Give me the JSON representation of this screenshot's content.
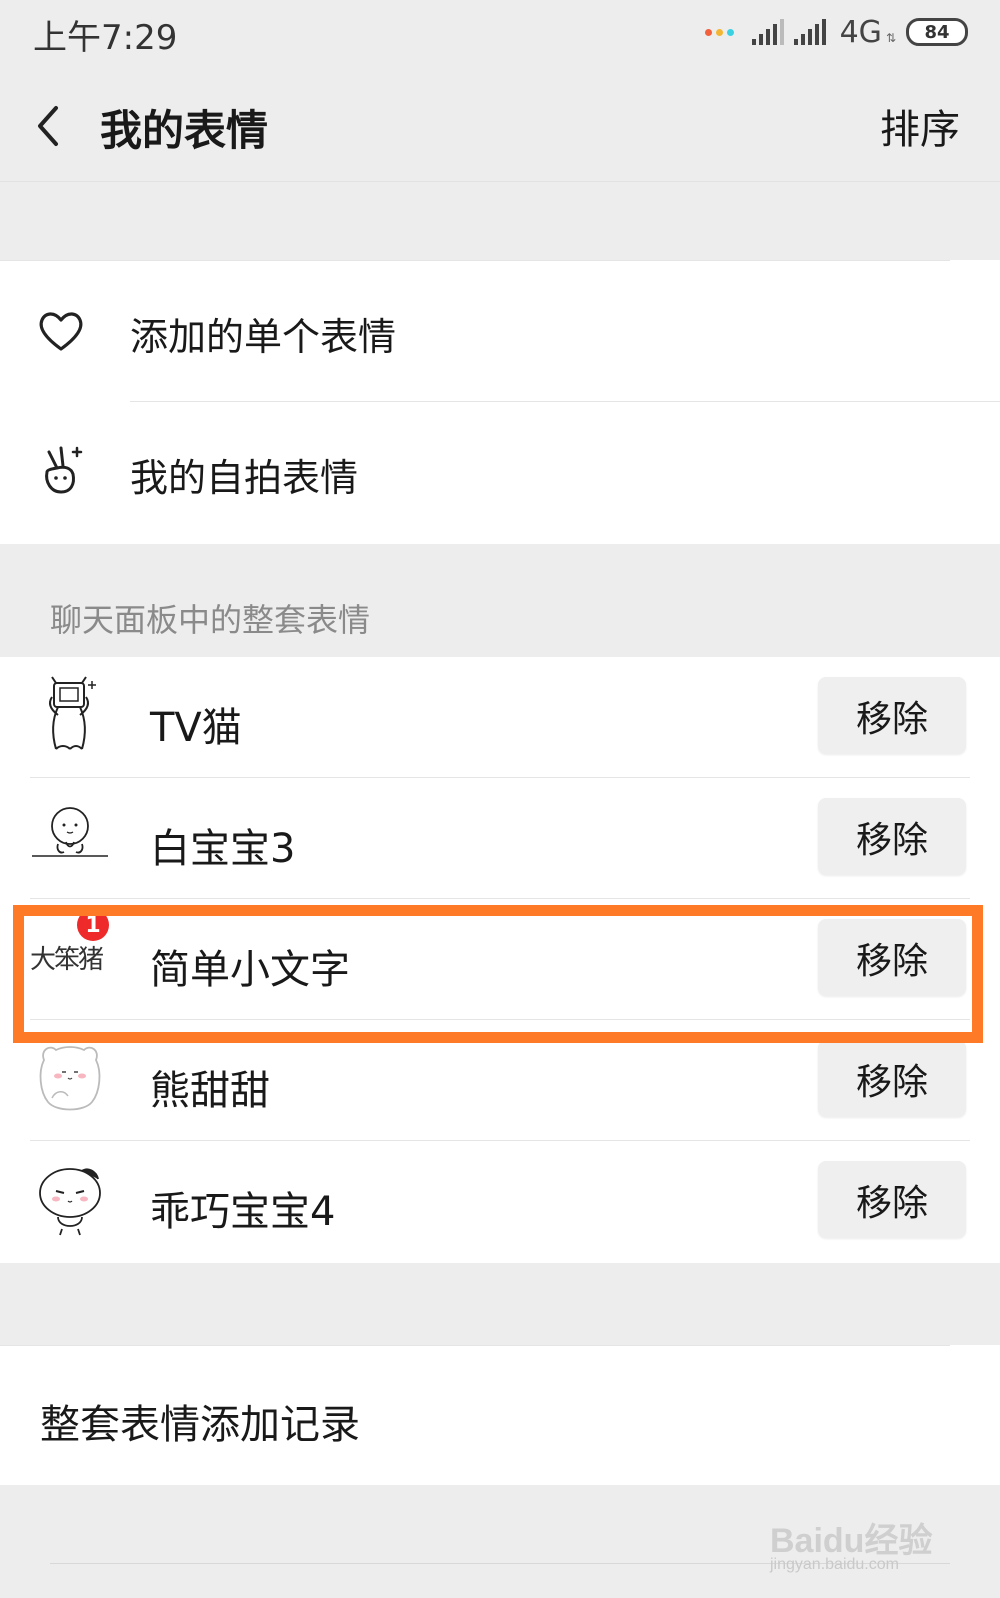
{
  "status_bar": {
    "time": "上午7:29",
    "network": "4G",
    "battery": "84",
    "dot_colors": [
      "#f2603c",
      "#f3b632",
      "#3ad1e3"
    ]
  },
  "nav": {
    "title": "我的表情",
    "sort_label": "排序",
    "back_icon": "chevron-left-icon"
  },
  "menu": [
    {
      "label": "添加的单个表情",
      "icon": "heart-icon"
    },
    {
      "label": "我的自拍表情",
      "icon": "victory-hand-icon"
    }
  ],
  "section_header": "聊天面板中的整套表情",
  "packs": [
    {
      "name": "TV猫",
      "action": "移除",
      "thumb": "tv-cat-sticker",
      "badge": null
    },
    {
      "name": "白宝宝3",
      "action": "移除",
      "thumb": "white-baby-sticker",
      "badge": null
    },
    {
      "name": "简单小文字",
      "action": "移除",
      "thumb": "text-sticker",
      "thumb_text": "大笨猪",
      "badge": "1",
      "highlighted": true
    },
    {
      "name": "熊甜甜",
      "action": "移除",
      "thumb": "bear-sticker",
      "badge": null
    },
    {
      "name": "乖巧宝宝4",
      "action": "移除",
      "thumb": "good-baby-sticker",
      "badge": null
    }
  ],
  "history_label": "整套表情添加记录",
  "highlight_color": "#ff7a26",
  "watermark": {
    "brand": "Baidu经验",
    "url": "jingyan.baidu.com"
  }
}
